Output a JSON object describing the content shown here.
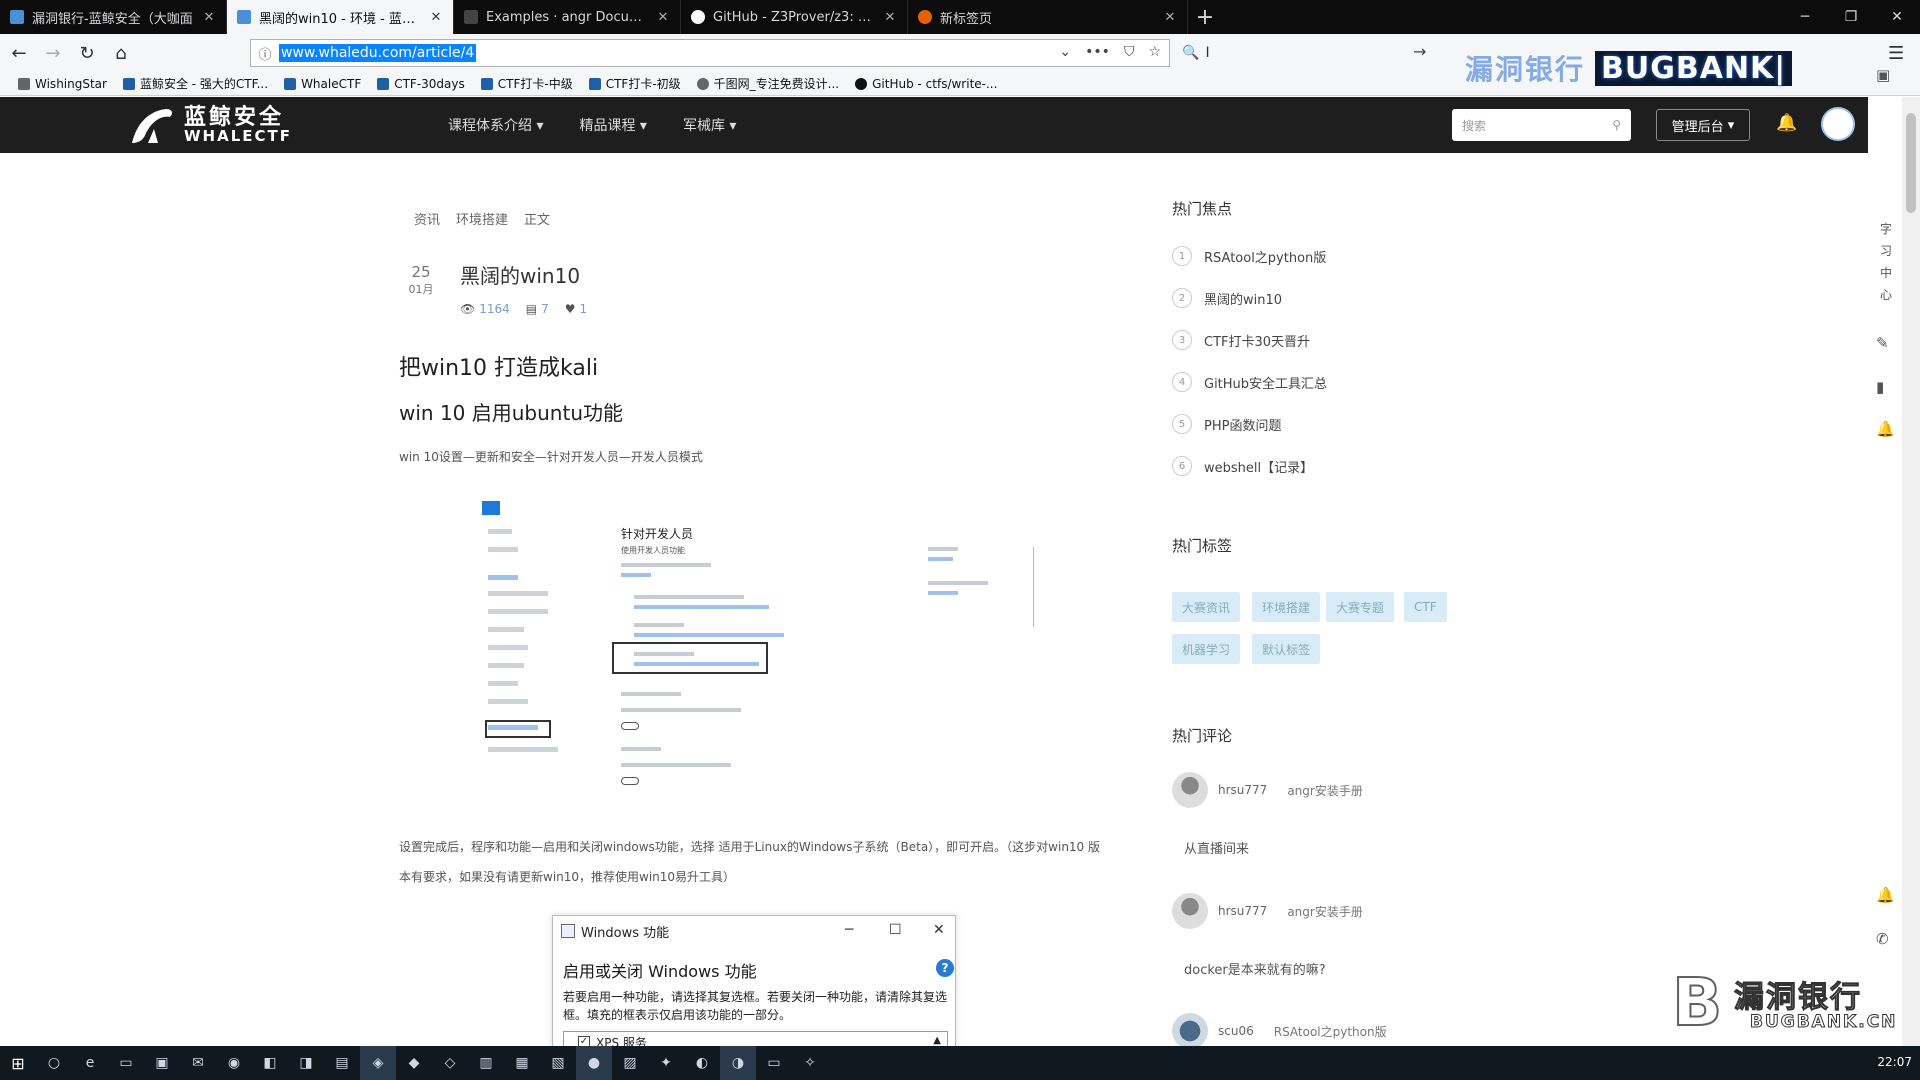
{
  "browser": {
    "tabs": [
      {
        "title": "漏洞银行-蓝鲸安全（大咖面",
        "active": false
      },
      {
        "title": "黑阔的win10 - 环境 - 蓝鲸安全",
        "active": true
      },
      {
        "title": "Examples · angr Documenta",
        "active": false
      },
      {
        "title": "GitHub - Z3Prover/z3: The",
        "active": false
      },
      {
        "title": "新标签页",
        "active": false
      }
    ],
    "new_tab": "+",
    "url": "www.whaledu.com/article/4",
    "search_text": "I",
    "bookmarks": [
      "WishingStar",
      "蓝鲸安全 - 强大的CTF...",
      "WhaleCTF",
      "CTF-30days",
      "CTF打卡-中级",
      "CTF打卡-初级",
      "千图网_专注免费设计...",
      "GitHub - ctfs/write-..."
    ]
  },
  "watermark": {
    "top_cn": "漏洞银行",
    "top_en": "BUGBANK|",
    "bottom_letter": "B",
    "bottom_cn": "漏洞银行",
    "bottom_en": "BUGBANK.CN"
  },
  "site": {
    "logo_cn": "蓝鲸安全",
    "logo_en": "WHALECTF",
    "nav": [
      "课程体系介绍",
      "精品课程",
      "军械库"
    ],
    "search_placeholder": "搜索",
    "admin_button": "管理后台"
  },
  "article": {
    "breadcrumbs": [
      "资讯",
      "环境搭建",
      "正文"
    ],
    "day": "25",
    "month": "01月",
    "title": "黑阔的win10",
    "views": "1164",
    "comments": "7",
    "likes": "1",
    "heading1": "把win10 打造成kali",
    "heading2": "win 10 启用ubuntu功能",
    "para1": "win 10设置—更新和安全—针对开发人员—开发人员模式",
    "para2": "设置完成后，程序和功能—启用和关闭windows功能，选择 适用于Linux的Windows子系统（Beta），即可开启。（这步对win10 版本有要求，如果没有请更新win10，推荐使用win10易升工具）",
    "shot1": {
      "heading": "针对开发人员",
      "subheading": "使用开发人员功能"
    },
    "dialog": {
      "window_title": "Windows 功能",
      "heading": "启用或关闭 Windows 功能",
      "help": "?",
      "description": "若要启用一种功能，请选择其复选框。若要关闭一种功能，请清除其复选框。填充的框表示仅启用该功能的一部分。",
      "first_item": "XPS 服务"
    }
  },
  "sidebar": {
    "hot_title": "热门焦点",
    "hot_items": [
      {
        "num": "1",
        "label": "RSAtool之python版"
      },
      {
        "num": "2",
        "label": "黑阔的win10"
      },
      {
        "num": "3",
        "label": "CTF打卡30天晋升"
      },
      {
        "num": "4",
        "label": "GitHub安全工具汇总"
      },
      {
        "num": "5",
        "label": "PHP函数问题"
      },
      {
        "num": "6",
        "label": "webshell【记录】"
      }
    ],
    "tags_title": "热门标签",
    "tags": [
      "大赛资讯",
      "环境搭建",
      "大赛专题",
      "CTF",
      "机器学习",
      "默认标签"
    ],
    "comments_title": "热门评论",
    "comments": [
      {
        "user": "hrsu777",
        "article": "angr安装手册",
        "text": "从直播间来"
      },
      {
        "user": "hrsu777",
        "article": "angr安装手册",
        "text": "docker是本来就有的嘛?"
      },
      {
        "user": "scu06",
        "article": "RSAtool之python版",
        "text": ""
      }
    ]
  },
  "rail": {
    "chars": [
      "字",
      "习",
      "中",
      "心"
    ]
  },
  "taskbar": {
    "clock": "22:07"
  }
}
